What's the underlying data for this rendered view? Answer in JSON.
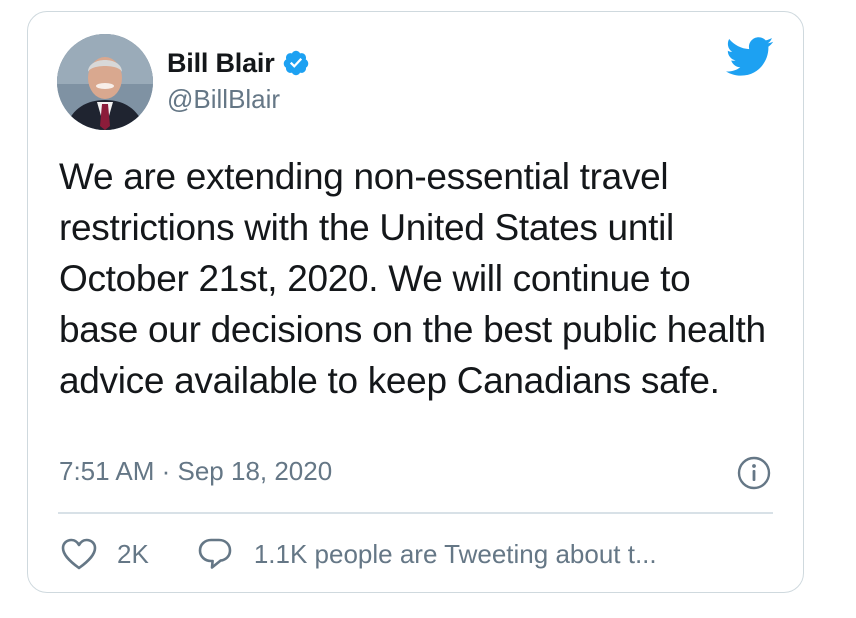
{
  "author": {
    "display_name": "Bill Blair",
    "handle": "@BillBlair",
    "verified": true
  },
  "tweet": {
    "text": "We are extending non-essential travel restrictions with the United States until October 21st, 2020. We will continue to base our decisions on the best public health advice available to keep Canadians safe.",
    "timestamp": "7:51 AM · Sep 18, 2020"
  },
  "actions": {
    "like_count": "2K",
    "reply_text": "1.1K people are Tweeting about t..."
  },
  "icons": {
    "brand": "twitter-bird-icon",
    "verified": "verified-badge-icon",
    "info": "info-icon",
    "like": "heart-icon",
    "reply": "speech-bubble-icon"
  },
  "colors": {
    "twitter_blue": "#1da1f2",
    "text_primary": "#14171a",
    "text_secondary": "#657786",
    "border": "#cfd9de"
  }
}
